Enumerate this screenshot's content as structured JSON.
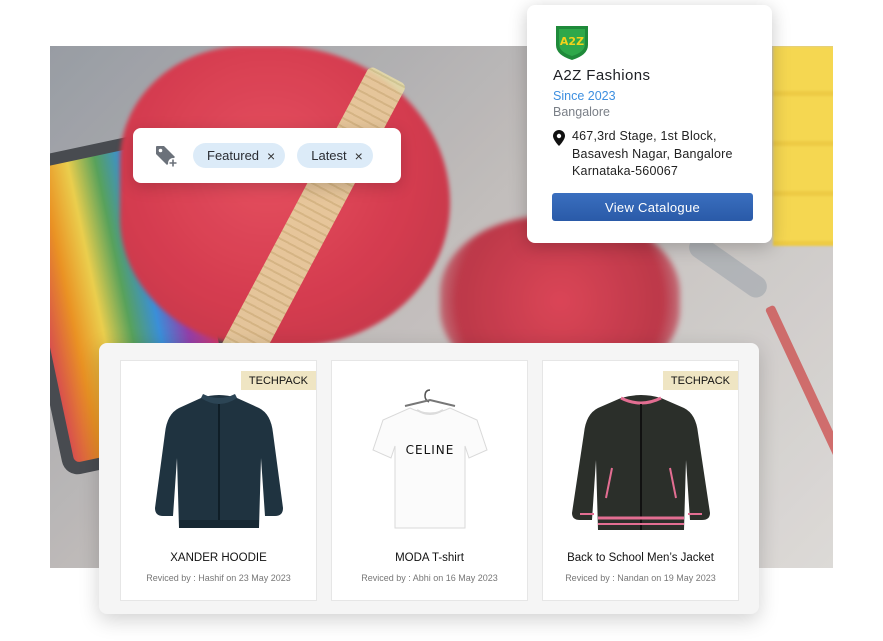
{
  "tags": {
    "chips": [
      {
        "label": "Featured"
      },
      {
        "label": "Latest"
      }
    ],
    "remove_symbol": "×",
    "add_icon": "tag-add-icon"
  },
  "store": {
    "logo_text": "A2Z",
    "name": "A2Z Fashions",
    "since": "Since 2023",
    "city": "Bangalore",
    "address_lines": [
      "467,3rd Stage, 1st Block,",
      "Basavesh Nagar, Bangalore",
      "Karnataka-560067"
    ],
    "cta_label": "View Catalogue",
    "colors": {
      "accent": "#2f63b3",
      "since": "#3d8fe0",
      "logo_green": "#1f8a3a",
      "logo_yellow": "#f2d21b"
    }
  },
  "products": [
    {
      "name": "XANDER HOODIE",
      "revised": "Reviced by : Hashif on 23 May 2023",
      "badge": "TECHPACK",
      "image": "navy-bomber-jacket"
    },
    {
      "name": "MODA T-shirt",
      "revised": "Reviced by : Abhi on 16 May 2023",
      "badge": "",
      "image": "white-tshirt",
      "print": "CELINE"
    },
    {
      "name": "Back to School Men’s Jacket",
      "revised": "Reviced by : Nandan on 19 May 2023",
      "badge": "TECHPACK",
      "image": "black-varsity-jacket"
    }
  ]
}
